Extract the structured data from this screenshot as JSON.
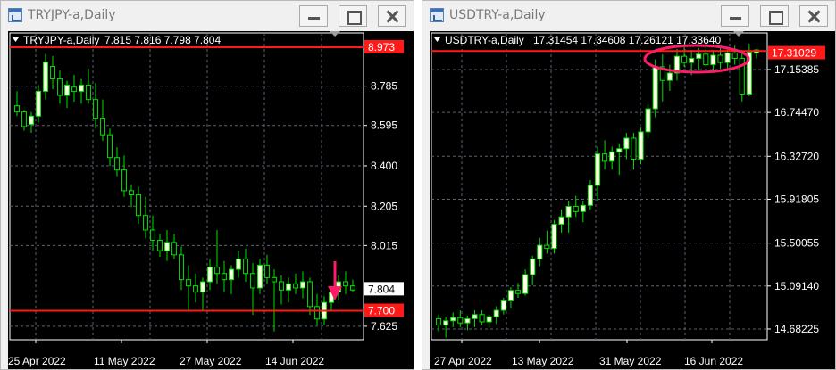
{
  "windows": [
    {
      "title": "TRYJPY-a,Daily",
      "chart_data": {
        "type": "candlestick",
        "symbol_label": "TRYJPY-a,Daily",
        "ohlc_header": [
          "7.815",
          "7.816",
          "7.798",
          "7.804"
        ],
        "y_tick_labels": [
          "8.785",
          "8.595",
          "8.400",
          "8.205",
          "8.015",
          "7.625"
        ],
        "y_ticks": [
          8.785,
          8.595,
          8.4,
          8.205,
          8.015,
          7.625
        ],
        "x_tick_labels": [
          "25 Apr 2022",
          "11 May 2022",
          "27 May 2022",
          "14 Jun 2022"
        ],
        "price_label": "7.804",
        "price_value": 7.804,
        "hlines": [
          {
            "label": "8.973",
            "value": 8.973
          },
          {
            "label": "7.700",
            "value": 7.7
          }
        ],
        "candles_ohlc": [
          [
            8.69,
            8.76,
            8.64,
            8.66
          ],
          [
            8.66,
            8.67,
            8.57,
            8.59
          ],
          [
            8.6,
            8.66,
            8.56,
            8.64
          ],
          [
            8.64,
            8.79,
            8.61,
            8.76
          ],
          [
            8.76,
            8.94,
            8.72,
            8.9
          ],
          [
            8.88,
            8.93,
            8.77,
            8.82
          ],
          [
            8.82,
            8.86,
            8.7,
            8.74
          ],
          [
            8.74,
            8.81,
            8.68,
            8.79
          ],
          [
            8.78,
            8.84,
            8.71,
            8.76
          ],
          [
            8.76,
            8.82,
            8.7,
            8.79
          ],
          [
            8.79,
            8.87,
            8.7,
            8.72
          ],
          [
            8.72,
            8.8,
            8.58,
            8.63
          ],
          [
            8.63,
            8.72,
            8.52,
            8.55
          ],
          [
            8.55,
            8.58,
            8.4,
            8.44
          ],
          [
            8.44,
            8.49,
            8.35,
            8.38
          ],
          [
            8.38,
            8.45,
            8.25,
            8.28
          ],
          [
            8.28,
            8.31,
            8.2,
            8.26
          ],
          [
            8.26,
            8.3,
            8.12,
            8.16
          ],
          [
            8.16,
            8.25,
            8.05,
            8.09
          ],
          [
            8.09,
            8.16,
            7.99,
            8.04
          ],
          [
            8.04,
            8.07,
            7.96,
            7.99
          ],
          [
            7.99,
            8.09,
            7.94,
            8.03
          ],
          [
            8.03,
            8.07,
            7.95,
            7.97
          ],
          [
            7.97,
            8.01,
            7.8,
            7.85
          ],
          [
            7.85,
            7.92,
            7.7,
            7.82
          ],
          [
            7.82,
            7.88,
            7.74,
            7.79
          ],
          [
            7.79,
            7.86,
            7.7,
            7.84
          ],
          [
            7.84,
            7.95,
            7.8,
            7.91
          ],
          [
            7.91,
            8.09,
            7.83,
            7.88
          ],
          [
            7.88,
            7.94,
            7.79,
            7.85
          ],
          [
            7.85,
            7.92,
            7.78,
            7.9
          ],
          [
            7.9,
            7.99,
            7.86,
            7.95
          ],
          [
            7.95,
            8.0,
            7.84,
            7.88
          ],
          [
            7.88,
            7.93,
            7.68,
            7.81
          ],
          [
            7.81,
            7.95,
            7.78,
            7.92
          ],
          [
            7.92,
            7.97,
            7.83,
            7.86
          ],
          [
            7.86,
            7.9,
            7.6,
            7.84
          ],
          [
            7.84,
            7.87,
            7.73,
            7.8
          ],
          [
            7.8,
            7.86,
            7.74,
            7.83
          ],
          [
            7.83,
            7.88,
            7.78,
            7.81
          ],
          [
            7.81,
            7.89,
            7.76,
            7.84
          ],
          [
            7.84,
            7.86,
            7.68,
            7.72
          ],
          [
            7.72,
            7.78,
            7.63,
            7.66
          ],
          [
            7.66,
            7.77,
            7.63,
            7.74
          ],
          [
            7.74,
            7.82,
            7.7,
            7.79
          ],
          [
            7.79,
            7.87,
            7.75,
            7.84
          ],
          [
            7.84,
            7.89,
            7.78,
            7.82
          ],
          [
            7.82,
            7.85,
            7.79,
            7.8
          ]
        ]
      }
    },
    {
      "title": "USDTRY-a,Daily",
      "chart_data": {
        "type": "candlestick",
        "symbol_label": "USDTRY-a,Daily",
        "ohlc_header": [
          "17.31454",
          "17.34608",
          "17.26121",
          "17.33640"
        ],
        "y_tick_labels": [
          "17.15385",
          "16.74470",
          "16.32720",
          "15.91805",
          "15.50055",
          "15.09140",
          "14.68225"
        ],
        "y_ticks": [
          17.15385,
          16.7447,
          16.3272,
          15.91805,
          15.50055,
          15.0914,
          14.68225
        ],
        "x_tick_labels": [
          "27 Apr 2022",
          "13 May 2022",
          "31 May 2022",
          "16 Jun 2022"
        ],
        "price_label": "17.31029",
        "price_value": 17.31029,
        "hlines": [
          {
            "label": "",
            "value": 17.33
          }
        ],
        "candles_ohlc": [
          [
            14.78,
            14.82,
            14.66,
            14.72
          ],
          [
            14.72,
            14.8,
            14.6,
            14.76
          ],
          [
            14.76,
            14.84,
            14.7,
            14.79
          ],
          [
            14.79,
            14.86,
            14.7,
            14.74
          ],
          [
            14.74,
            14.81,
            14.67,
            14.78
          ],
          [
            14.78,
            14.86,
            14.7,
            14.82
          ],
          [
            14.82,
            14.86,
            14.72,
            14.75
          ],
          [
            14.75,
            14.82,
            14.7,
            14.8
          ],
          [
            14.8,
            14.9,
            14.73,
            14.86
          ],
          [
            14.86,
            14.98,
            14.82,
            14.95
          ],
          [
            14.95,
            15.08,
            14.88,
            15.05
          ],
          [
            15.05,
            15.12,
            14.98,
            15.02
          ],
          [
            15.02,
            15.25,
            15.0,
            15.2
          ],
          [
            15.2,
            15.38,
            15.1,
            15.35
          ],
          [
            15.35,
            15.55,
            15.28,
            15.48
          ],
          [
            15.48,
            15.62,
            15.4,
            15.45
          ],
          [
            15.45,
            15.72,
            15.4,
            15.68
          ],
          [
            15.68,
            15.82,
            15.6,
            15.75
          ],
          [
            15.75,
            15.9,
            15.6,
            15.85
          ],
          [
            15.85,
            15.95,
            15.75,
            15.8
          ],
          [
            15.8,
            15.9,
            15.7,
            15.86
          ],
          [
            15.86,
            16.1,
            15.82,
            16.05
          ],
          [
            16.05,
            16.42,
            15.9,
            16.35
          ],
          [
            16.35,
            16.48,
            16.2,
            16.28
          ],
          [
            16.28,
            16.42,
            16.2,
            16.37
          ],
          [
            16.37,
            16.45,
            16.15,
            16.4
          ],
          [
            16.4,
            16.55,
            16.3,
            16.5
          ],
          [
            16.5,
            16.55,
            16.2,
            16.3
          ],
          [
            16.3,
            16.6,
            16.25,
            16.56
          ],
          [
            16.56,
            16.82,
            16.5,
            16.78
          ],
          [
            16.78,
            17.25,
            16.7,
            17.18
          ],
          [
            17.18,
            17.3,
            16.85,
            17.05
          ],
          [
            17.05,
            17.2,
            16.95,
            17.12
          ],
          [
            17.12,
            17.35,
            17.05,
            17.28
          ],
          [
            17.28,
            17.4,
            17.18,
            17.22
          ],
          [
            17.22,
            17.34,
            17.1,
            17.26
          ],
          [
            17.26,
            17.36,
            17.15,
            17.3
          ],
          [
            17.3,
            17.38,
            17.18,
            17.2
          ],
          [
            17.2,
            17.34,
            17.12,
            17.29
          ],
          [
            17.29,
            17.37,
            17.16,
            17.22
          ],
          [
            17.22,
            17.35,
            17.14,
            17.31
          ],
          [
            17.31,
            17.38,
            17.2,
            17.26
          ],
          [
            17.26,
            17.34,
            16.85,
            16.92
          ],
          [
            16.92,
            17.4,
            16.9,
            17.32
          ],
          [
            17.31,
            17.35,
            17.26,
            17.34
          ]
        ]
      }
    }
  ],
  "colors": {
    "background": "#000000",
    "grid": "#5a6472",
    "bull_fill": "#ffffe6",
    "bull_wick": "#00e000",
    "bear_fill": "#000000",
    "bear_wick": "#00e000",
    "hline": "#ff1a1a",
    "price_label_bg": "#ffffff",
    "annotation": "#ff1a6a"
  },
  "annotations": {
    "left_down_arrow": "down-arrow",
    "right_ellipse": "highlight-ellipse"
  }
}
